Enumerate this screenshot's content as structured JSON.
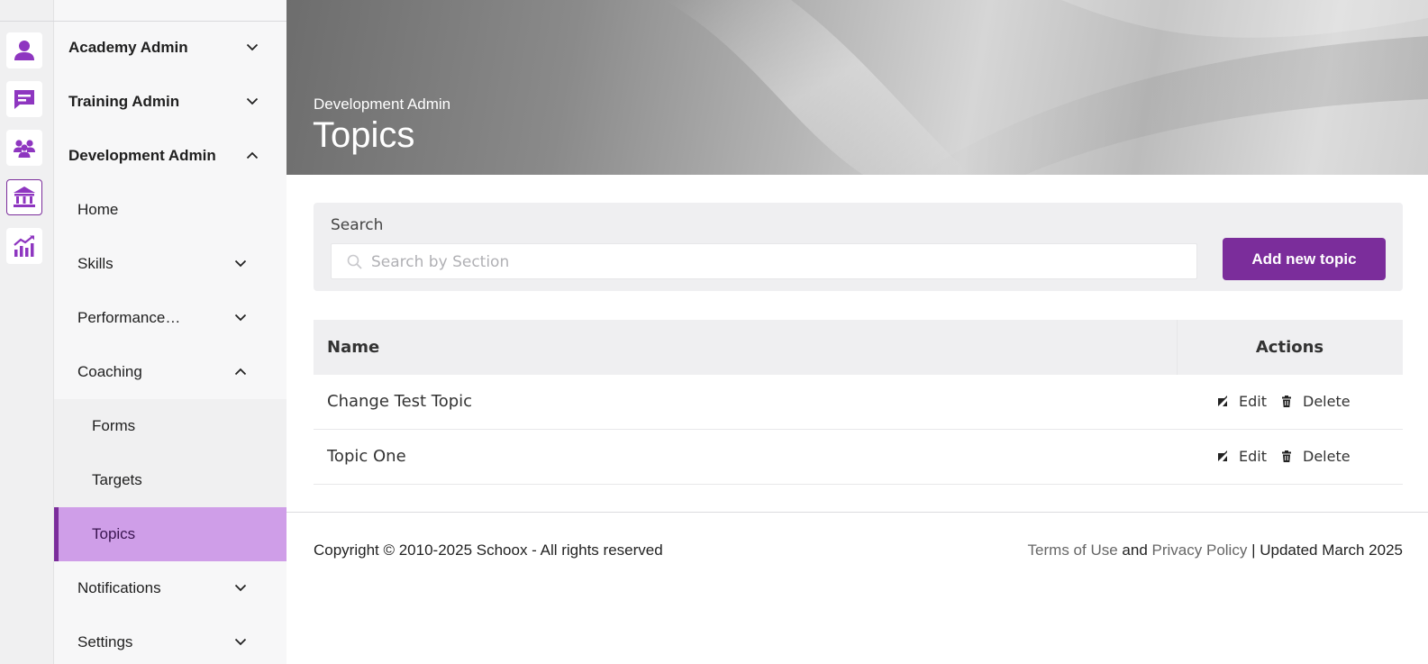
{
  "rail": {
    "items": [
      {
        "icon": "person-icon"
      },
      {
        "icon": "chat-icon"
      },
      {
        "icon": "users-icon"
      },
      {
        "icon": "institution-icon",
        "active": true
      },
      {
        "icon": "analytics-icon"
      }
    ]
  },
  "sidebar": {
    "academy_admin": "Academy Admin",
    "training_admin": "Training Admin",
    "development_admin": "Development Admin",
    "home": "Home",
    "skills": "Skills",
    "performance": "Performance…",
    "coaching": "Coaching",
    "forms": "Forms",
    "targets": "Targets",
    "topics": "Topics",
    "notifications": "Notifications",
    "settings": "Settings"
  },
  "header": {
    "breadcrumb": "Development Admin",
    "title": "Topics"
  },
  "search": {
    "label": "Search",
    "placeholder": "Search by Section",
    "value": ""
  },
  "toolbar": {
    "add_label": "Add new topic"
  },
  "table": {
    "columns": [
      "Name",
      "Actions"
    ],
    "rows": [
      {
        "name": "Change Test Topic",
        "edit": "Edit",
        "delete": "Delete"
      },
      {
        "name": "Topic One",
        "edit": "Edit",
        "delete": "Delete"
      }
    ]
  },
  "footer": {
    "copyright": "Copyright © 2010-2025 Schoox - All rights reserved",
    "terms": "Terms of Use",
    "and": "and",
    "privacy": "Privacy Policy",
    "updated": "| Updated March 2025"
  },
  "colors": {
    "accent": "#7b2d9b",
    "icon": "#8e36c0",
    "selected_bg": "#cf9ee8"
  }
}
